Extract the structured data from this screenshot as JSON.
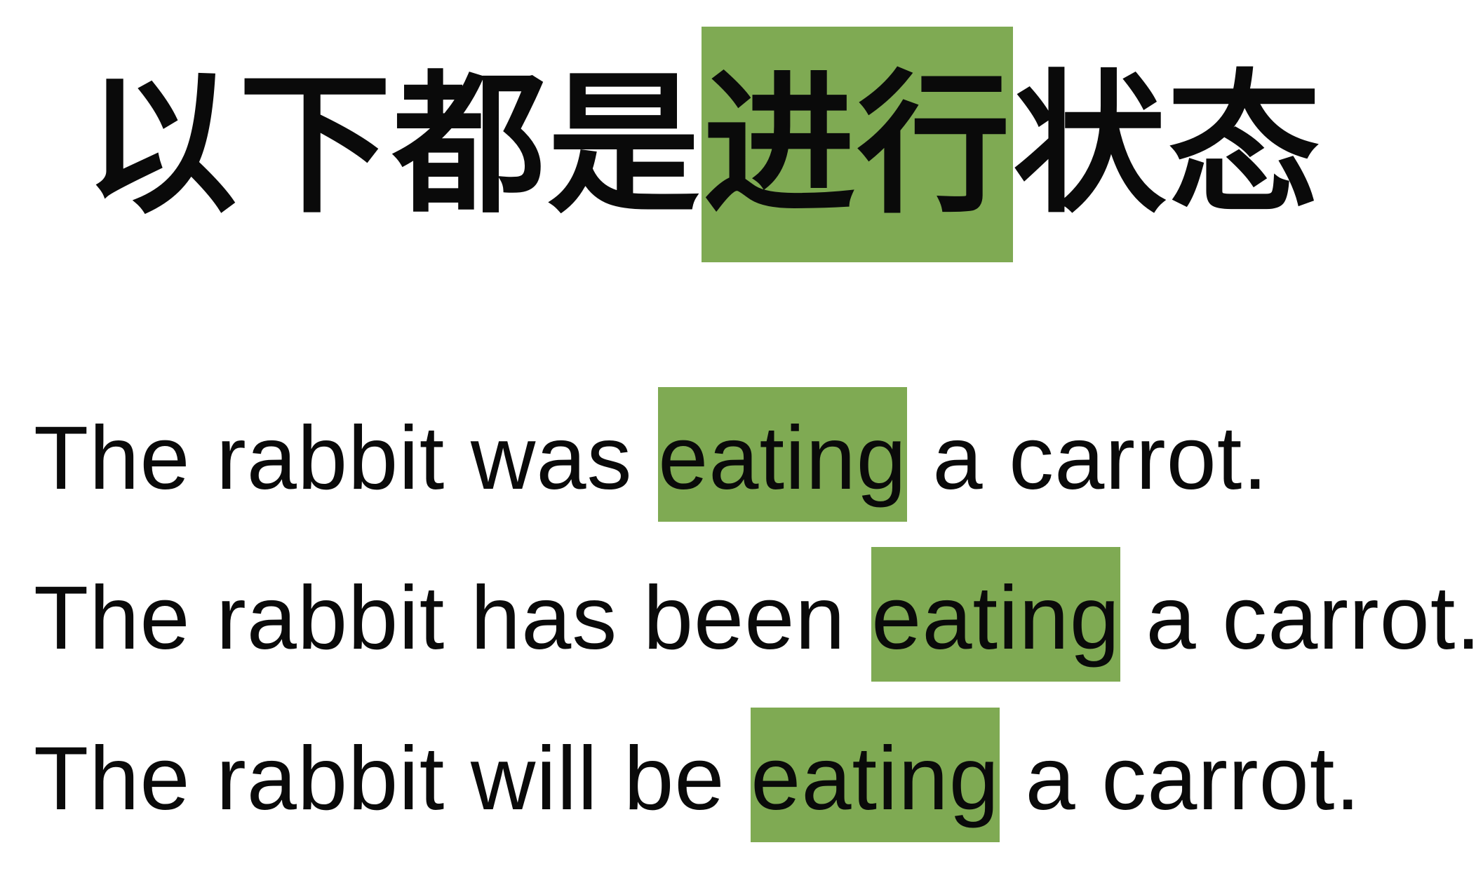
{
  "title": {
    "before": "以下都是",
    "highlight": "进行",
    "after": "状态"
  },
  "sentences": [
    {
      "before": "The rabbit was ",
      "highlight": "eating",
      "after": " a carrot."
    },
    {
      "before": "The rabbit has been ",
      "highlight": "eating",
      "after": " a carrot."
    },
    {
      "before": "The rabbit will be ",
      "highlight": "eating",
      "after": " a carrot."
    }
  ],
  "colors": {
    "highlight": "#7faa53",
    "text": "#0a0a0a",
    "background": "#ffffff"
  }
}
